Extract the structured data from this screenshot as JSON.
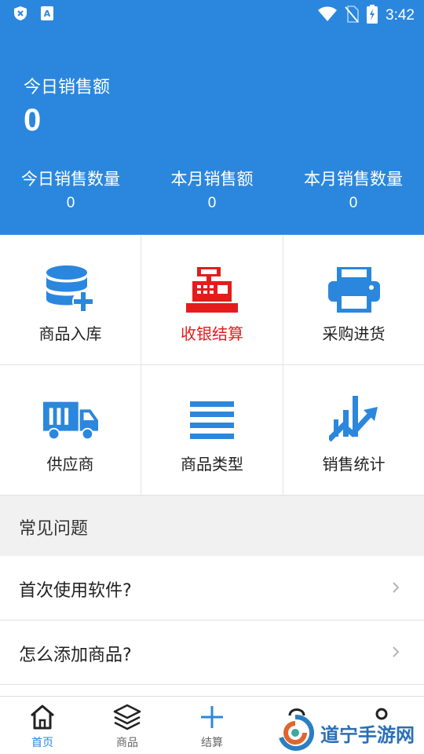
{
  "statusbar": {
    "time": "3:42"
  },
  "summary": {
    "today_sales_label": "今日销售额",
    "today_sales_value": "0",
    "stats": [
      {
        "label": "今日销售数量",
        "value": "0"
      },
      {
        "label": "本月销售额",
        "value": "0"
      },
      {
        "label": "本月销售数量",
        "value": "0"
      }
    ]
  },
  "grid": {
    "items": [
      {
        "label": "商品入库",
        "icon": "database-add-icon"
      },
      {
        "label": "收银结算",
        "icon": "cash-register-icon",
        "color": "#e51c1c"
      },
      {
        "label": "采购进货",
        "icon": "printer-icon"
      },
      {
        "label": "供应商",
        "icon": "truck-icon"
      },
      {
        "label": "商品类型",
        "icon": "list-icon"
      },
      {
        "label": "销售统计",
        "icon": "trend-chart-icon"
      }
    ],
    "accent": "#2b87dd"
  },
  "faq": {
    "title": "常见问题",
    "items": [
      {
        "question": "首次使用软件?"
      },
      {
        "question": "怎么添加商品?"
      }
    ]
  },
  "tabbar": {
    "tabs": [
      {
        "label": "首页",
        "icon": "home-icon",
        "active": true
      },
      {
        "label": "商品",
        "icon": "layers-icon"
      },
      {
        "label": "结算",
        "icon": "plus-icon"
      },
      {
        "label": "",
        "icon": "bag-icon"
      },
      {
        "label": "",
        "icon": "user-icon"
      }
    ]
  },
  "watermark": {
    "text": "道宁手游网"
  }
}
